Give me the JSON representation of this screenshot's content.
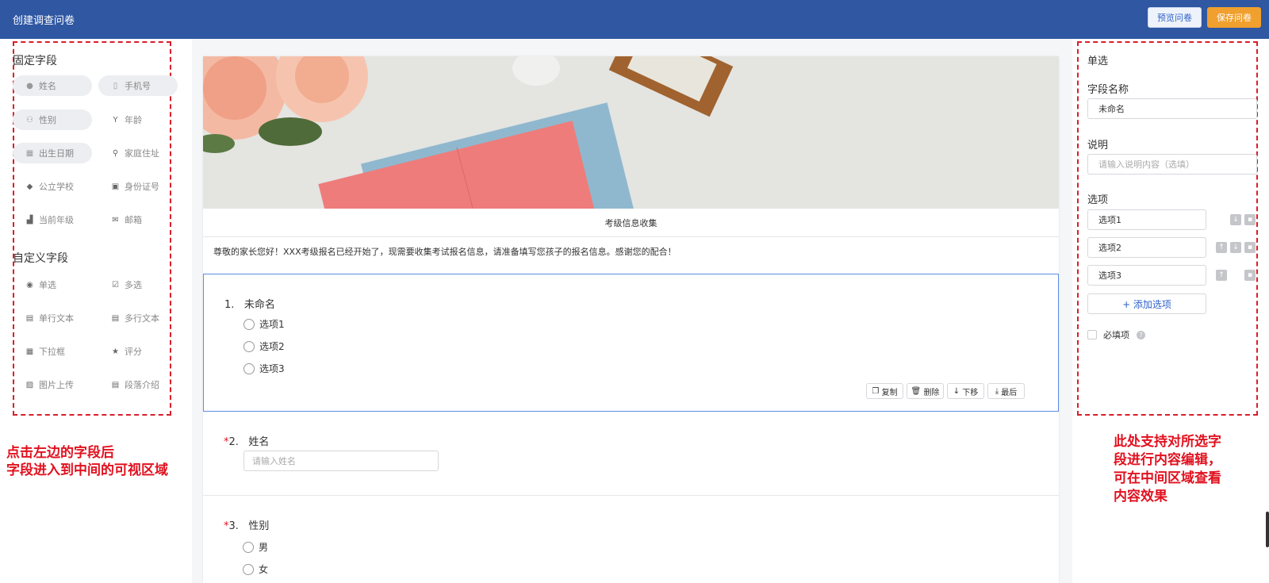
{
  "header": {
    "title": "创建调查问卷",
    "preview_label": "预览问卷",
    "save_label": "保存问卷"
  },
  "left": {
    "fixed_title": "固定字段",
    "fixed_fields": [
      "姓名",
      "手机号",
      "性别",
      "年龄",
      "出生日期",
      "家庭住址",
      "公立学校",
      "身份证号",
      "当前年级",
      "邮箱"
    ],
    "custom_title": "自定义字段",
    "custom_fields": [
      "单选",
      "多选",
      "单行文本",
      "多行文本",
      "下拉框",
      "评分",
      "图片上传",
      "段落介绍"
    ],
    "annotation": [
      "点击左边的字段后",
      "字段进入到中间的可视区域"
    ]
  },
  "form": {
    "title": "考级信息收集",
    "description": "尊敬的家长您好！XXX考级报名已经开始了，现需要收集考试报名信息，请准备填写您孩子的报名信息。感谢您的配合！",
    "q1": {
      "num": "1.",
      "label": "未命名",
      "options": [
        "选项1",
        "选项2",
        "选项3"
      ]
    },
    "toolbar": {
      "copy": "复制",
      "delete": "删除",
      "move_down": "下移",
      "last": "最后"
    },
    "q2": {
      "req": "*",
      "num": "2.",
      "label": "姓名",
      "placeholder": "请输入姓名"
    },
    "q3": {
      "req": "*",
      "num": "3.",
      "label": "性别",
      "options": [
        "男",
        "女"
      ]
    }
  },
  "right": {
    "type": "单选",
    "field_name_label": "字段名称",
    "field_name_value": "未命名",
    "desc_label": "说明",
    "desc_placeholder": "请输入说明内容（选填）",
    "options_label": "选项",
    "options": [
      "选项1",
      "选项2",
      "选项3"
    ],
    "add_option": "+ 添加选项",
    "required_label": "必填项",
    "annotation": [
      "此处支持对所选字",
      "段进行内容编辑，",
      "可在中间区域查看",
      "内容效果"
    ]
  },
  "colors": {
    "header": "#2f57a2",
    "save": "#f0a02e",
    "annotation": "#e1111f",
    "selected_border": "#5b8de3"
  }
}
